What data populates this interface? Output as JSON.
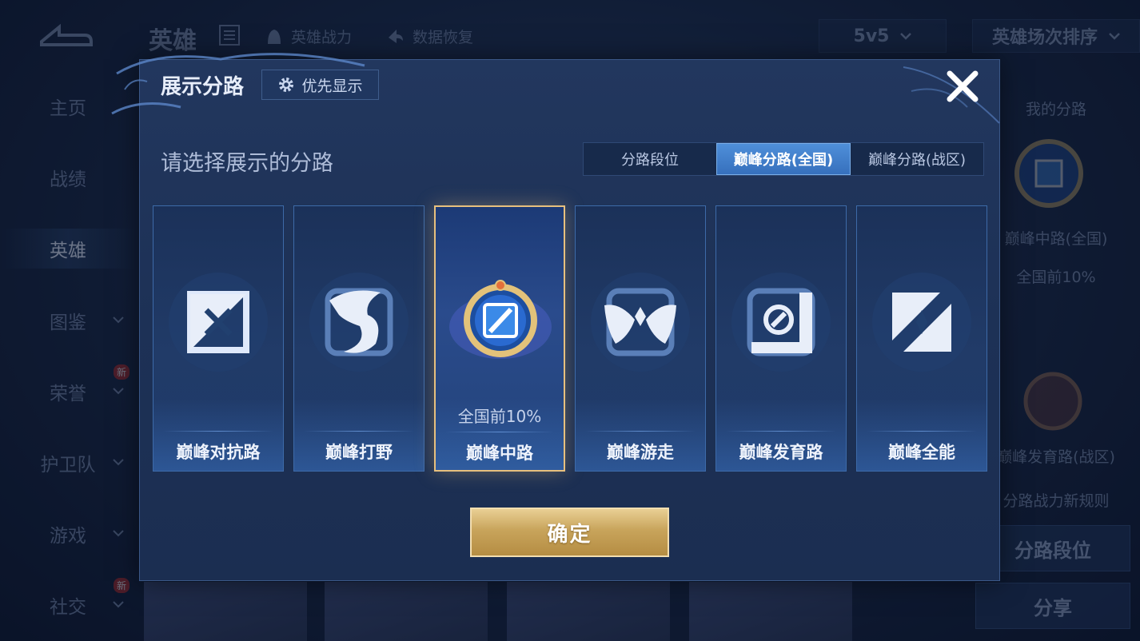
{
  "background": {
    "top_title": "英雄",
    "top_items": [
      "英雄战力",
      "数据恢复"
    ],
    "mode_dropdown": "5v5",
    "sort_dropdown": "英雄场次排序",
    "sidebar": [
      {
        "label": "主页"
      },
      {
        "label": "战绩"
      },
      {
        "label": "英雄"
      },
      {
        "label": "图鉴"
      },
      {
        "label": "荣誉"
      },
      {
        "label": "护卫队"
      },
      {
        "label": "游戏"
      },
      {
        "label": "社交"
      }
    ],
    "new_badge": "新",
    "right_panel": {
      "title": "我的分路",
      "lane_name": "巅峰中路(全国)",
      "lane_rank": "全国前10%",
      "lane2_name": "巅峰发育路(战区)",
      "rules_link": "分路战力新规则",
      "btn_lane_rank": "分路段位",
      "btn_share": "分享"
    }
  },
  "modal": {
    "title": "展示分路",
    "priority_button": "优先显示",
    "subtitle": "请选择展示的分路",
    "tabs": [
      {
        "label": "分路段位",
        "active": false
      },
      {
        "label": "巅峰分路(全国)",
        "active": true
      },
      {
        "label": "巅峰分路(战区)",
        "active": false
      }
    ],
    "cards": [
      {
        "label": "巅峰对抗路",
        "icon": "clash-lane-icon"
      },
      {
        "label": "巅峰打野",
        "icon": "jungle-icon"
      },
      {
        "label": "巅峰中路",
        "icon": "mid-lane-emblem-icon",
        "rank": "全国前10%",
        "selected": true
      },
      {
        "label": "巅峰游走",
        "icon": "roam-icon"
      },
      {
        "label": "巅峰发育路",
        "icon": "farm-lane-icon"
      },
      {
        "label": "巅峰全能",
        "icon": "all-round-icon"
      }
    ],
    "confirm_button": "确定"
  },
  "colors": {
    "accent_gold": "#e7c07e",
    "tab_active": "#3f7fcc",
    "card_border": "#3d6aa8"
  }
}
